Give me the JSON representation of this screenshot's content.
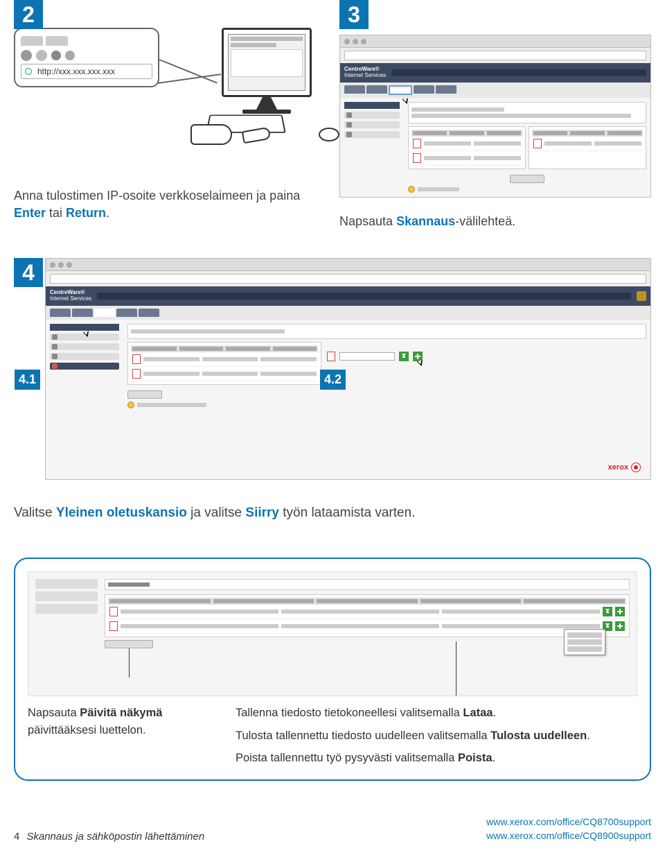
{
  "steps": {
    "s2": "2",
    "s3": "3",
    "s4": "4",
    "s4_1": "4.1",
    "s4_2": "4.2"
  },
  "url_bar": "http://xxx.xxx.xxx.xxx",
  "centreware": {
    "line1": "CentreWare®",
    "line2": "Internet Services"
  },
  "captions": {
    "step2_a": "Anna tulostimen IP-osoite verkkoselaimeen ja paina ",
    "step2_b_enter": "Enter",
    "step2_c": " tai ",
    "step2_d_return": "Return",
    "step2_e": ".",
    "step3_a": "Napsauta ",
    "step3_b": "Skannaus",
    "step3_c": "-välilehteä.",
    "step4_a": "Valitse ",
    "step4_b": "Yleinen oletuskansio",
    "step4_c": " ja valitse ",
    "step4_d": "Siirry",
    "step4_e": " työn lataamista varten."
  },
  "callout": {
    "left_a": "Napsauta ",
    "left_b": "Päivitä näkymä",
    "left_c": " päivittääksesi luettelon.",
    "r1_a": "Tallenna tiedosto tietokoneellesi valitsemalla ",
    "r1_b": "Lataa",
    "r1_c": ".",
    "r2_a": "Tulosta tallennettu tiedosto uudelleen valitsemalla ",
    "r2_b": "Tulosta uudelleen",
    "r2_c": ".",
    "r3_a": "Poista tallennettu työ pysyvästi valitsemalla ",
    "r3_b": "Poista",
    "r3_c": "."
  },
  "xerox": "xerox",
  "footer": {
    "page": "4",
    "title": "Skannaus ja sähköpostin lähettäminen",
    "url1": "www.xerox.com/office/CQ8700support",
    "url2": "www.xerox.com/office/CQ8900support"
  }
}
